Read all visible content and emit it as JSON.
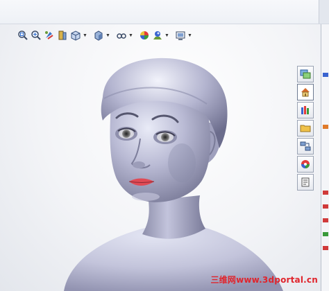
{
  "toolbar": {
    "icons": [
      {
        "name": "zoom-to-fit-icon",
        "dropdown": false
      },
      {
        "name": "zoom-to-area-icon",
        "dropdown": false
      },
      {
        "name": "previous-view-icon",
        "dropdown": false
      },
      {
        "name": "section-view-icon",
        "dropdown": false
      },
      {
        "name": "view-orientation-icon",
        "dropdown": true
      },
      {
        "name": "display-style-icon",
        "dropdown": true
      },
      {
        "name": "hide-show-items-icon",
        "dropdown": true
      },
      {
        "name": "edit-appearance-icon",
        "dropdown": false
      },
      {
        "name": "apply-scene-icon",
        "dropdown": true
      },
      {
        "name": "view-settings-icon",
        "dropdown": true
      }
    ]
  },
  "task_pane": {
    "tabs": [
      {
        "name": "solidworks-resources-icon",
        "active": false
      },
      {
        "name": "home-icon",
        "active": true
      },
      {
        "name": "design-library-icon",
        "active": false
      },
      {
        "name": "file-explorer-icon",
        "active": false
      },
      {
        "name": "view-palette-icon",
        "active": false
      },
      {
        "name": "appearances-icon",
        "active": false
      },
      {
        "name": "custom-properties-icon",
        "active": false
      }
    ]
  },
  "colors": {
    "model_base": "#b7b8d2",
    "model_highlight": "#eef0fa",
    "model_shadow": "#6f6f8e",
    "lips": "#e04a55",
    "watermark": "#e0242c"
  },
  "watermark": {
    "text": "三维网www.3dportal.cn"
  }
}
